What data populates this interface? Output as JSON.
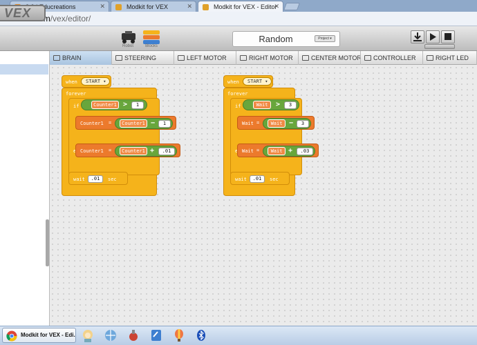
{
  "browser_tabs": [
    {
      "title": "8.2 | Educreations",
      "fav": "#e08a2a"
    },
    {
      "title": "Modkit for VEX",
      "fav": "#e0a12a"
    },
    {
      "title": "Modkit for VEX - Editor",
      "fav": "#e0a12a"
    }
  ],
  "address": {
    "host": "w.modkit.com",
    "path": "/vex/editor/"
  },
  "header": {
    "logo_text": "VEX",
    "robot_label": "Robot",
    "blocks_label": "Blocks",
    "project_title": "Random",
    "project_dropdown": "Project ▾"
  },
  "device_tabs": [
    "BRAIN",
    "STEERING",
    "LEFT MOTOR",
    "RIGHT MOTOR",
    "CENTER MOTOR",
    "CONTROLLER",
    "RIGHT LED"
  ],
  "script1": {
    "when": "when",
    "event": "START",
    "forever": "forever",
    "if": "if",
    "cond_var": "Counter1",
    "cond_op": ">",
    "cond_val": "1",
    "set1_var": "Counter1",
    "set1_eq": "=",
    "set1_inner_var": "Counter1",
    "set1_op": "−",
    "set1_val": "1",
    "else": "else",
    "set2_var": "Counter1",
    "set2_eq": "=",
    "set2_inner_var": "Counter1",
    "set2_op": "+",
    "set2_val": ".01",
    "wait": "wait",
    "wait_val": ".01",
    "wait_unit": "sec"
  },
  "script2": {
    "when": "when",
    "event": "START",
    "forever": "forever",
    "if": "if",
    "cond_var": "Wait",
    "cond_op": ">",
    "cond_val": "3",
    "set1_var": "Wait",
    "set1_eq": "=",
    "set1_inner_var": "Wait",
    "set1_op": "−",
    "set1_val": "3",
    "else": "else",
    "set2_var": "Wait",
    "set2_eq": "=",
    "set2_inner_var": "Wait",
    "set2_op": "+",
    "set2_val": ".03",
    "wait": "wait",
    "wait_val": ".01",
    "wait_unit": "sec"
  },
  "taskbar": {
    "active_app": "Modkit for VEX - Edi..."
  },
  "colors": {
    "control": "#f5b31b",
    "variable": "#ec7a2c",
    "operator": "#68a63c",
    "accent": "#cde0f2"
  }
}
